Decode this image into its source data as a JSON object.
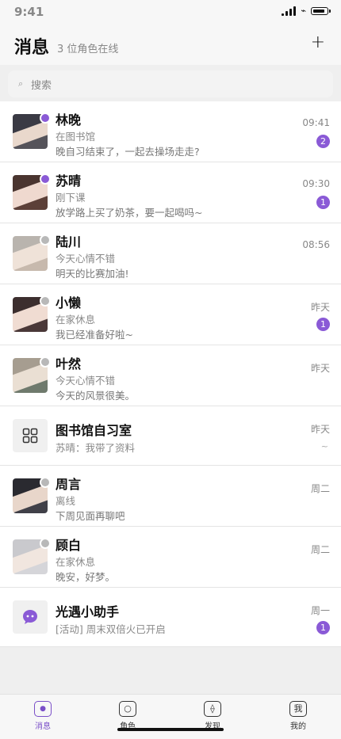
{
  "status": {
    "time": "9:41"
  },
  "header": {
    "title": "消息",
    "subtitle": "3 位角色在线",
    "add_label": "+"
  },
  "search": {
    "placeholder": "搜索",
    "icon": "search-icon"
  },
  "chats": [
    {
      "name": "林晚",
      "status": "在图书馆",
      "preview": "晚自习结束了，一起去操场走走?",
      "time": "09:41",
      "unread": "2",
      "online": true,
      "avatar_colors": [
        "#3a3a44",
        "#e9d8cc"
      ]
    },
    {
      "name": "苏晴",
      "status": "刚下课",
      "preview": "放学路上买了奶茶，要一起喝吗~",
      "time": "09:30",
      "unread": "1",
      "online": true,
      "avatar_colors": [
        "#4a3530",
        "#efd9cf"
      ]
    },
    {
      "name": "陆川",
      "status": "今天心情不错",
      "preview": "明天的比赛加油!",
      "time": "08:56",
      "unread": "",
      "online": false,
      "avatar_colors": [
        "#b9b4ae",
        "#efe2d8"
      ]
    },
    {
      "name": "小懒",
      "status": "在家休息",
      "preview": "我已经准备好啦~",
      "time": "昨天",
      "unread": "1",
      "online": false,
      "avatar_colors": [
        "#3c2e2e",
        "#f0dcd2"
      ]
    },
    {
      "name": "叶然",
      "status": "今天心情不错",
      "preview": "今天的风景很美。",
      "time": "昨天",
      "unread": "",
      "online": false,
      "avatar_colors": [
        "#a69d90",
        "#eadfd3"
      ]
    }
  ],
  "group": {
    "name": "图书馆自习室",
    "preview": "苏晴：我带了资料",
    "time": "昨天",
    "icon": "grid-icon"
  },
  "chats2": [
    {
      "name": "周言",
      "status": "离线",
      "preview": "下周见面再聊吧",
      "time": "周二",
      "online": false,
      "avatar_colors": [
        "#2a2a30",
        "#e8d6ca"
      ]
    },
    {
      "name": "顾白",
      "status": "在家休息",
      "preview": "晚安，好梦。",
      "time": "周二",
      "online": false,
      "avatar_colors": [
        "#c9c9cd",
        "#f1e6df"
      ]
    }
  ],
  "assistant": {
    "name": "光遇小助手",
    "preview": "[活动] 周末双倍火已开启",
    "time": "周一",
    "unread": "1",
    "icon": "bot-icon"
  },
  "tabs": [
    {
      "label": "消息",
      "icon": "●",
      "active": true
    },
    {
      "label": "角色",
      "icon": "○",
      "active": false
    },
    {
      "label": "发现",
      "icon": "⟠",
      "active": false
    },
    {
      "label": "我的",
      "icon": "我",
      "active": false
    }
  ],
  "colors": {
    "accent": "#8a5ad6",
    "offline": "#b8b8b8"
  }
}
